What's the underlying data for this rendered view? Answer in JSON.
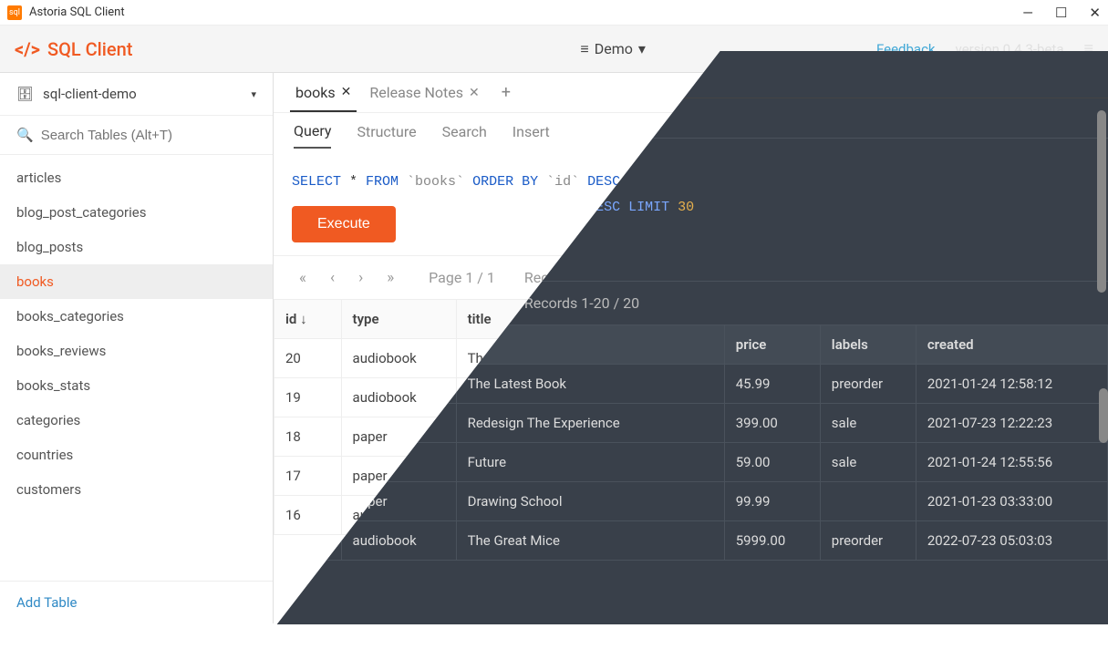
{
  "window": {
    "title": "Astoria SQL Client"
  },
  "header": {
    "app_name": "SQL Client",
    "db_selector": "Demo",
    "feedback": "Feedback",
    "version": "version 0.4.3-beta"
  },
  "sidebar": {
    "database": "sql-client-demo",
    "search_placeholder": "Search Tables (Alt+T)",
    "items": [
      "articles",
      "blog_post_categories",
      "blog_posts",
      "books",
      "books_categories",
      "books_reviews",
      "books_stats",
      "categories",
      "countries",
      "customers"
    ],
    "active_index": 3,
    "add_table": "Add Table"
  },
  "tabs": {
    "items": [
      {
        "label": "books",
        "closable": true,
        "active": true
      },
      {
        "label": "Release Notes",
        "closable": true,
        "active": false
      }
    ]
  },
  "subtabs": {
    "items": [
      "Query",
      "Structure",
      "Search",
      "Insert"
    ],
    "active_index": 0
  },
  "query": {
    "tokens": [
      "SELECT",
      " * ",
      "FROM",
      " `books` ",
      "ORDER BY",
      " `id` ",
      "DESC",
      " ",
      "LIMIT",
      " ",
      "30"
    ],
    "execute": "Execute"
  },
  "pager": {
    "page_text": "Page 1 / 1",
    "records_text": "Records 1-20 / 20"
  },
  "table": {
    "columns": [
      "id",
      "type",
      "title",
      "price",
      "labels",
      "created"
    ],
    "sort_col": "id",
    "rows": [
      {
        "id": "20",
        "type": "audiobook",
        "title": "The Latest Book",
        "price": "45.99",
        "labels": "preorder",
        "created": "2021-01-24 12:58:12"
      },
      {
        "id": "19",
        "type": "audiobook",
        "title": "Redesign The Experience",
        "price": "399.00",
        "labels": "sale",
        "created": "2021-07-23 12:22:23"
      },
      {
        "id": "18",
        "type": "paper",
        "title": "Future",
        "price": "59.00",
        "labels": "sale",
        "created": "2021-01-24 12:55:56"
      },
      {
        "id": "17",
        "type": "paper",
        "title": "Drawing School",
        "price": "99.99",
        "labels": "",
        "created": "2021-01-23 03:33:00"
      },
      {
        "id": "16",
        "type": "audiobook",
        "title": "The Great Mice",
        "price": "5999.00",
        "labels": "preorder",
        "created": "2022-07-23 05:03:03"
      }
    ]
  }
}
